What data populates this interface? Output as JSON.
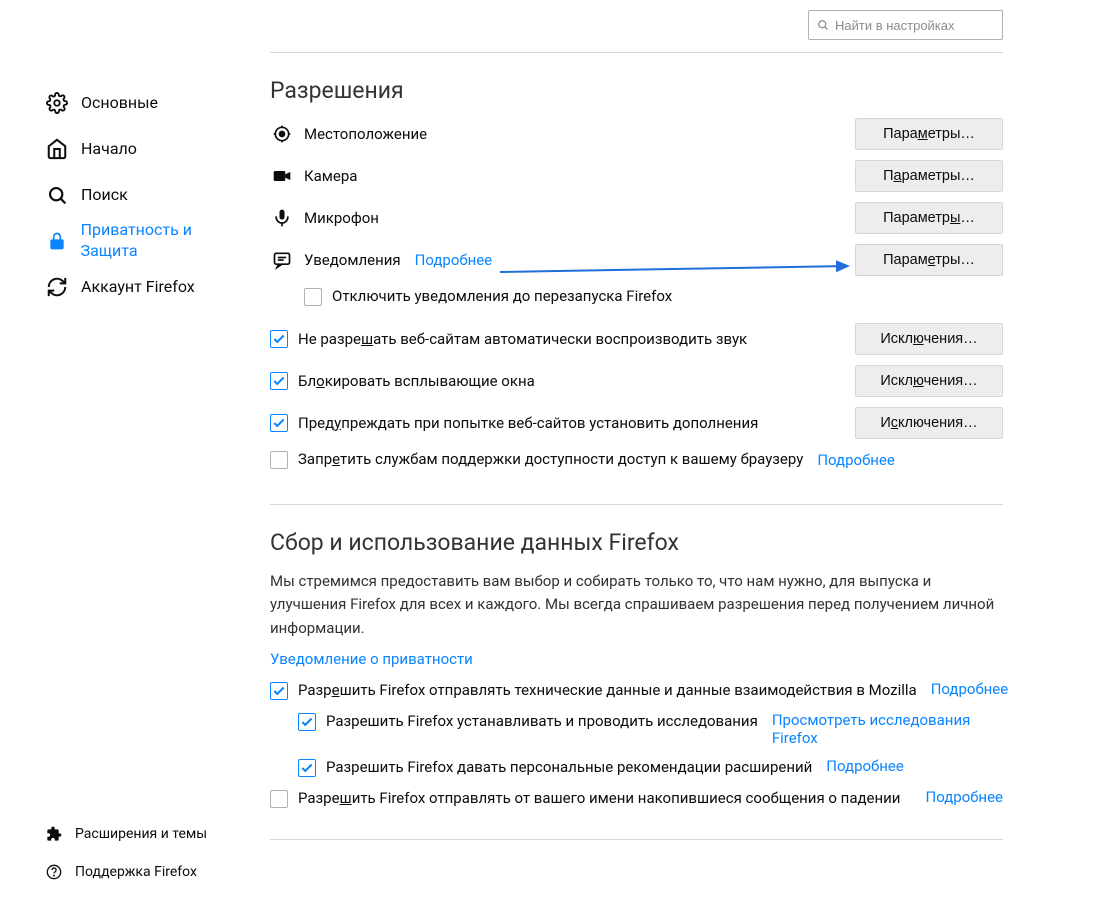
{
  "search": {
    "placeholder": "Найти в настройках"
  },
  "sidebar": {
    "items": [
      {
        "label": "Основные"
      },
      {
        "label": "Начало"
      },
      {
        "label": "Поиск"
      },
      {
        "label": "Приватность и Защита"
      },
      {
        "label": "Аккаунт Firefox"
      }
    ],
    "footer": [
      {
        "label": "Расширения и темы"
      },
      {
        "label": "Поддержка Firefox"
      }
    ]
  },
  "permissions": {
    "title": "Разрешения",
    "items": [
      {
        "label": "Местоположение",
        "button": "Параметры…"
      },
      {
        "label": "Камера",
        "button": "Параметры…"
      },
      {
        "label": "Микрофон",
        "button": "Параметры…"
      },
      {
        "label": "Уведомления",
        "button": "Параметры…",
        "link": "Подробнее"
      }
    ],
    "disable_notifications": "Отключить уведомления до перезапуска Firefox",
    "checks": [
      {
        "label": "Не разрешать веб-сайтам автоматически воспроизводить звук",
        "button": "Исключения…",
        "checked": true
      },
      {
        "label": "Блокировать всплывающие окна",
        "button": "Исключения…",
        "checked": true
      },
      {
        "label": "Предупреждать при попытке веб-сайтов установить дополнения",
        "button": "Исключения…",
        "checked": true
      }
    ],
    "access": {
      "label": "Запретить службам поддержки доступности доступ к вашему браузеру",
      "link": "Подробнее",
      "checked": false
    }
  },
  "datacollection": {
    "title": "Сбор и использование данных Firefox",
    "intro": "Мы стремимся предоставить вам выбор и собирать только то, что нам нужно, для выпуска и улучшения Firefox для всех и каждого. Мы всегда спрашиваем разрешения перед получением личной информации.",
    "privacy_link": "Уведомление о приватности",
    "checks": [
      {
        "label": "Разрешить Firefox отправлять технические данные и данные взаимодействия в Mozilla",
        "link": "Подробнее",
        "checked": true,
        "indent": 0
      },
      {
        "label": "Разрешить Firefox устанавливать и проводить исследования",
        "link": "Просмотреть исследования Firefox",
        "checked": true,
        "indent": 1
      },
      {
        "label": "Разрешить Firefox давать персональные рекомендации расширений",
        "link": "Подробнее",
        "checked": true,
        "indent": 1
      },
      {
        "label": "Разрешить Firefox отправлять от вашего имени накопившиеся сообщения о падении",
        "link": "Подробнее",
        "checked": false,
        "indent": 0
      }
    ]
  }
}
